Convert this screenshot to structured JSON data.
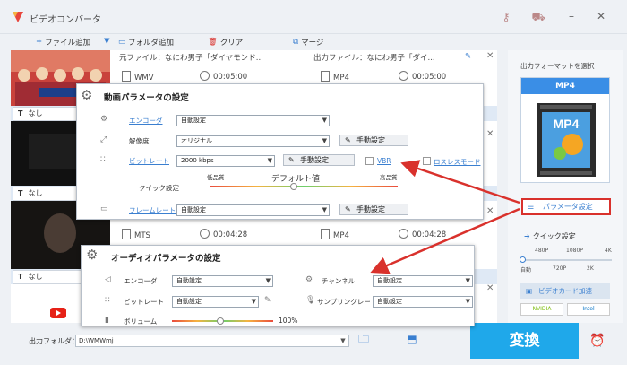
{
  "window": {
    "title": "ビデオコンバータ",
    "accent": "#3a8ee6"
  },
  "toolbar": {
    "add_file": "ファイル追加",
    "add_folder": "フォルダ追加",
    "clear": "クリア",
    "merge": "マージ"
  },
  "files": [
    {
      "source_name": "元ファイル：なにわ男子「ダイヤモンド...",
      "source_format": "WMV",
      "source_duration": "00:05:00",
      "output_name": "出力ファイル：なにわ男子「ダイ...",
      "output_format": "MP4",
      "output_duration": "00:05:00",
      "subtitle": "なし"
    },
    {
      "source_format": "MTS",
      "source_duration": "00:04:28",
      "output_format": "MP4",
      "output_duration": "00:04:28",
      "subtitle": "なし"
    }
  ],
  "subtitle_rows": [
    "なし",
    "なし",
    "なし"
  ],
  "subtitle_prefix": "T",
  "side": {
    "title": "出力フォーマットを選択",
    "format": "MP4",
    "format_badge": "MP4",
    "param_button": "パラメータ設定",
    "quick_label": "クイック設定",
    "ticks_top": [
      "480P",
      "1080P",
      "4K"
    ],
    "ticks_bottom": [
      "自動",
      "720P",
      "2K"
    ],
    "gpu_button": "ビデオカード加速",
    "vendor_nvidia": "NVIDIA",
    "vendor_intel": "Intel"
  },
  "video_params": {
    "title": "動画パラメータの設定",
    "encoder_label": "エンコーダ",
    "encoder_value": "自動設定",
    "resolution_label": "解像度",
    "resolution_value": "オリジナル",
    "manual_1": "手動設定",
    "bitrate_label": "ビットレート",
    "bitrate_value": "2000 kbps",
    "manual_2": "手動設定",
    "vbr_label": "VBR",
    "lossless_label": "ロスレスモード",
    "quick_label": "クイック設定",
    "low_quality": "低品質",
    "default_value": "デフォルト値",
    "high_quality": "高品質",
    "framerate_label": "フレームレート",
    "framerate_value": "自動設定",
    "manual_3": "手動設定"
  },
  "audio_params": {
    "title": "オーディオパラメータの設定",
    "encoder_label": "エンコーダ",
    "encoder_value": "自動設定",
    "channel_label": "チャンネル",
    "channel_value": "自動設定",
    "bitrate_label": "ビットレート",
    "bitrate_value": "自動設定",
    "samplerate_label": "サンプリングレート",
    "samplerate_value": "自動設定",
    "volume_label": "ボリューム",
    "volume_value": "100%"
  },
  "output": {
    "folder_label": "出力フォルダ：",
    "folder_path": "D:\\WMWmj"
  },
  "convert_button": "変換"
}
